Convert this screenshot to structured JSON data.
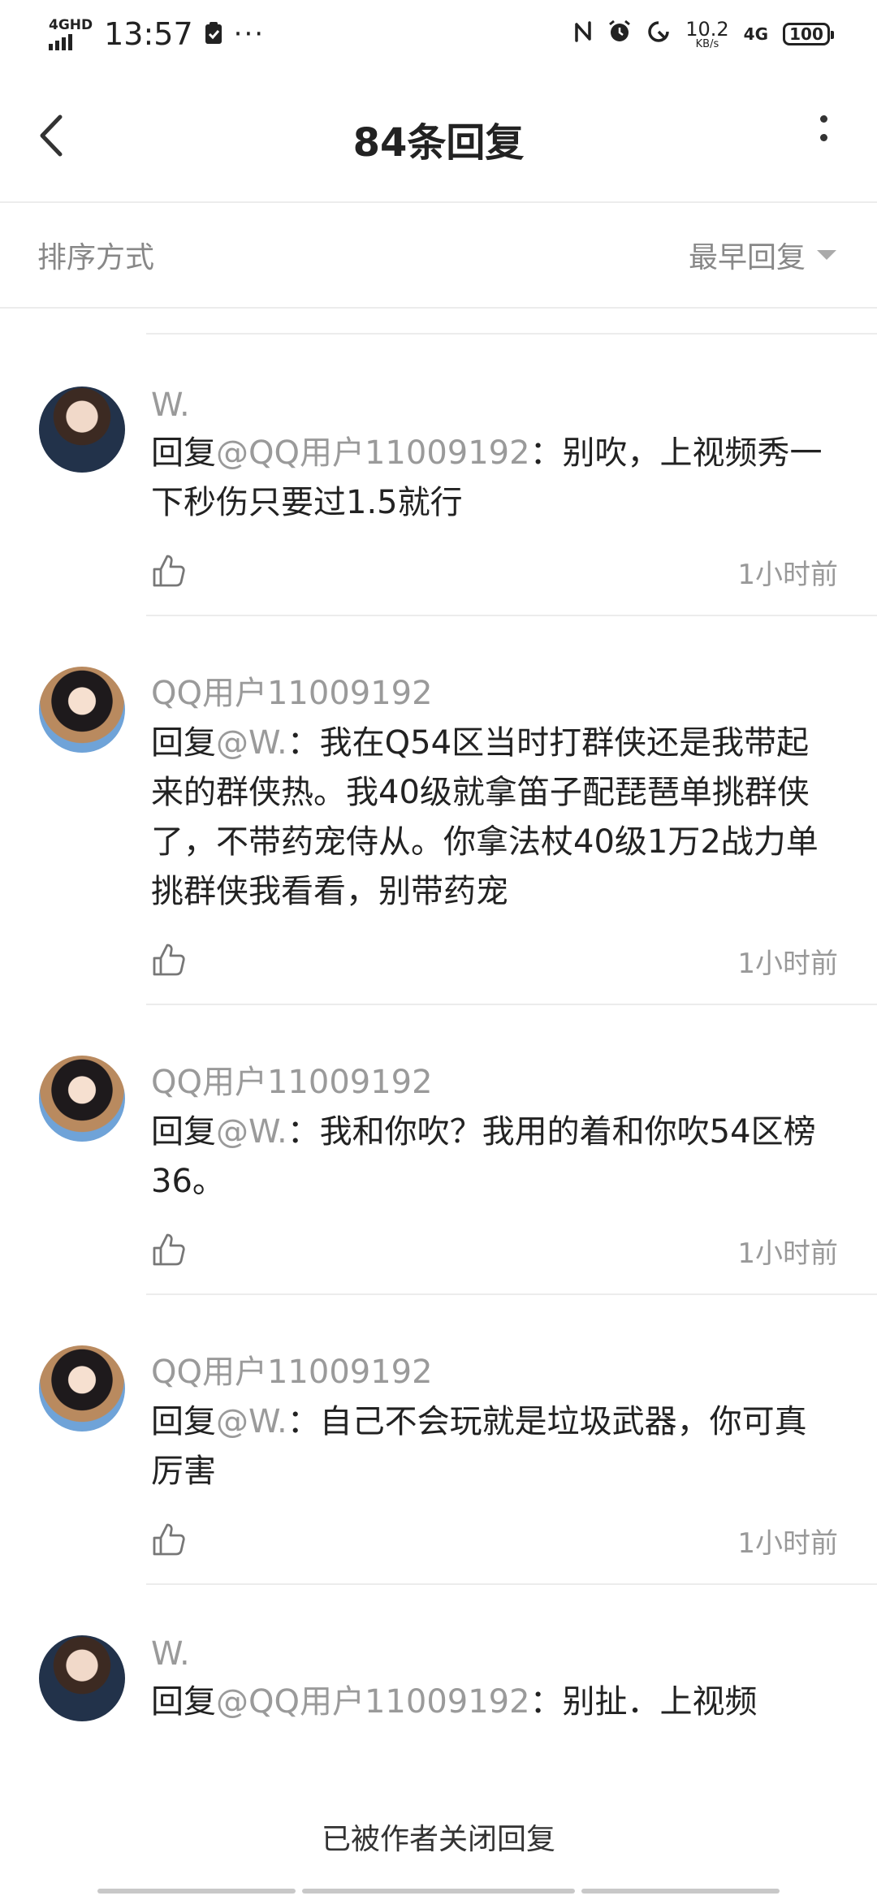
{
  "status_bar": {
    "network_badge": "4GHD",
    "time": "13:57",
    "dots": "···",
    "speed_value": "10.2",
    "speed_unit": "KB/s",
    "net_type": "4G",
    "battery": "100"
  },
  "nav": {
    "title": "84条回复"
  },
  "sort": {
    "label": "排序方式",
    "selected": "最早回复"
  },
  "replies": [
    {
      "username": "W.",
      "prefix": "回复",
      "mention": "@QQ用户11009192",
      "text": "：别吹，上视频秀一下秒伤只要过1.5就行",
      "time": "1小时前"
    },
    {
      "username": "QQ用户11009192",
      "prefix": "回复",
      "mention": "@W.",
      "text": "：我在Q54区当时打群侠还是我带起来的群侠热。我40级就拿笛子配琵琶单挑群侠了，不带药宠侍从。你拿法杖40级1万2战力单挑群侠我看看，别带药宠",
      "time": "1小时前"
    },
    {
      "username": "QQ用户11009192",
      "prefix": "回复",
      "mention": "@W.",
      "text": "：我和你吹？我用的着和你吹54区榜36。",
      "time": "1小时前"
    },
    {
      "username": "QQ用户11009192",
      "prefix": "回复",
      "mention": "@W.",
      "text": "：自己不会玩就是垃圾武器，你可真厉害",
      "time": "1小时前"
    },
    {
      "username": "W.",
      "prefix": "回复",
      "mention": "@QQ用户11009192",
      "text": "：别扯．上视频",
      "time": ""
    }
  ],
  "footer": {
    "closed_notice": "已被作者关闭回复"
  }
}
